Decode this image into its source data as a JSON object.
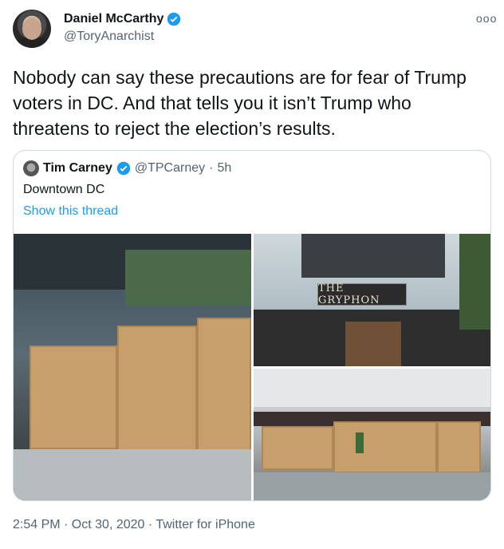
{
  "author": {
    "name": "Daniel McCarthy",
    "handle": "@ToryAnarchist",
    "verified_color": "#1d9bf0"
  },
  "tweet": {
    "text": "Nobody can say these precautions are for fear of Trump voters in DC. And that tells you it isn’t Trump who threatens to reject the election’s results."
  },
  "quoted": {
    "name": "Tim Carney",
    "handle": "@TPCarney",
    "separator": "·",
    "time": "5h",
    "text": "Downtown DC",
    "link": "Show this thread"
  },
  "media": {
    "sign_text": "THE GRYPHON"
  },
  "footer": {
    "timestamp": "2:54 PM · Oct 30, 2020 · Twitter for iPhone"
  }
}
